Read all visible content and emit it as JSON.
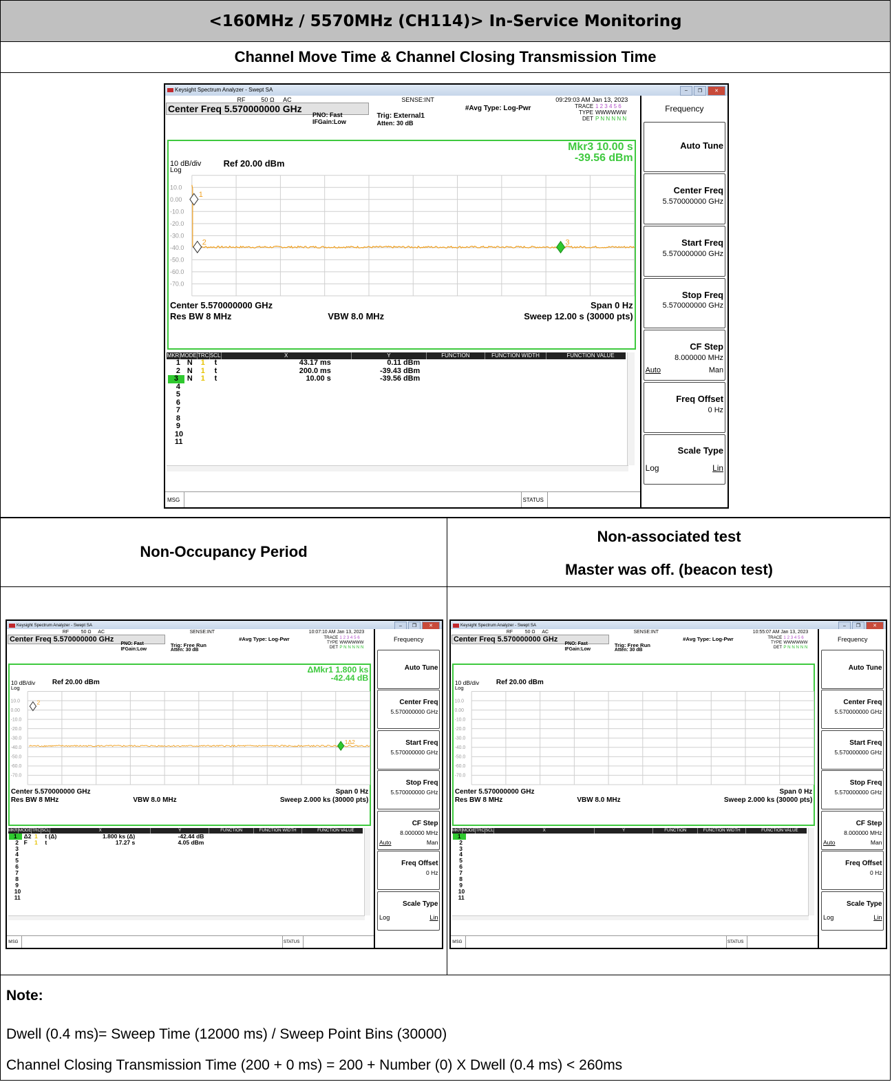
{
  "header": {
    "title": "<160MHz / 5570MHz (CH114)> In-Service Monitoring",
    "section1": "Channel Move Time & Channel Closing Transmission Time",
    "section2_left": "Non-Occupancy Period",
    "section2_right_line1": "Non-associated test",
    "section2_right_line2": "Master was off. (beacon test)"
  },
  "note": {
    "label": "Note:",
    "line1": "Dwell (0.4 ms)= Sweep Time (12000 ms) / Sweep Point Bins (30000)",
    "line2": "Channel Closing Transmission Time (200 + 0 ms) = 200 + Number (0) X Dwell (0.4 ms) < 260ms"
  },
  "screens": [
    {
      "app_title": "Keysight Spectrum Analyzer - Swept SA",
      "rf": "RF",
      "impedance": "50 Ω",
      "coupling": "AC",
      "sense": "SENSE:INT",
      "time": "09:29:03 AM Jan 13, 2023",
      "center_freq": "Center Freq 5.570000000 GHz",
      "pno": "PNO: Fast",
      "ifgain": "IFGain:Low",
      "trig": "Trig: External1",
      "atten": "Atten: 30 dB",
      "avg_type": "#Avg Type: Log-Pwr",
      "trace_label": "TRACE",
      "trace_nums": "1 2 3 4 5 6",
      "type_label": "TYPE",
      "type_val": "WWWWWW",
      "det_label": "DET",
      "det_val": "P N N N N N",
      "marker_readout_1": "Mkr3 10.00 s",
      "marker_readout_2": "-39.56 dBm",
      "scale": "10 dB/div",
      "ref": "Ref 20.00 dBm",
      "log": "Log",
      "y_ticks": [
        "10.0",
        "0.00",
        "-10.0",
        "-20.0",
        "-30.0",
        "-40.0",
        "-50.0",
        "-60.0",
        "-70.0"
      ],
      "center": "Center 5.570000000 GHz",
      "span": "Span 0 Hz",
      "rbw": "Res BW 8 MHz",
      "vbw": "VBW 8.0 MHz",
      "sweep": "Sweep  12.00 s (30000 pts)",
      "markers": [
        {
          "label": "1",
          "x": 0.043,
          "y": 0.11
        },
        {
          "label": "2",
          "x": 0.2,
          "y": -39.43
        },
        {
          "label": "3",
          "x": 10.0,
          "y": -39.56
        }
      ],
      "trace_level": -39.5,
      "table_headers": [
        "MKR",
        "MODE",
        "TRC",
        "SCL",
        "X",
        "Y",
        "FUNCTION",
        "FUNCTION WIDTH",
        "FUNCTION VALUE"
      ],
      "table_rows": [
        [
          "1",
          "N",
          "1",
          "t",
          "43.17 ms",
          "0.11 dBm"
        ],
        [
          "2",
          "N",
          "1",
          "t",
          "200.0 ms",
          "-39.43 dBm"
        ],
        [
          "3",
          "N",
          "1",
          "t",
          "10.00 s",
          "-39.56 dBm"
        ],
        [
          "4",
          "",
          "",
          "",
          "",
          ""
        ],
        [
          "5",
          "",
          "",
          "",
          "",
          ""
        ],
        [
          "6",
          "",
          "",
          "",
          "",
          ""
        ],
        [
          "7",
          "",
          "",
          "",
          "",
          ""
        ],
        [
          "8",
          "",
          "",
          "",
          "",
          ""
        ],
        [
          "9",
          "",
          "",
          "",
          "",
          ""
        ],
        [
          "10",
          "",
          "",
          "",
          "",
          ""
        ],
        [
          "11",
          "",
          "",
          "",
          "",
          ""
        ]
      ],
      "msg": "MSG",
      "status": "STATUS",
      "menu": {
        "title": "Frequency",
        "auto_tune": "Auto Tune",
        "center_freq": "Center Freq",
        "center_val": "5.570000000 GHz",
        "start_freq": "Start Freq",
        "start_val": "5.570000000 GHz",
        "stop_freq": "Stop Freq",
        "stop_val": "5.570000000 GHz",
        "cf_step": "CF Step",
        "cf_step_val": "8.000000 MHz",
        "auto": "Auto",
        "man": "Man",
        "freq_offset": "Freq Offset",
        "freq_offset_val": "0 Hz",
        "scale_type": "Scale Type",
        "log": "Log",
        "lin": "Lin"
      }
    },
    {
      "app_title": "Keysight Spectrum Analyzer - Swept SA",
      "rf": "RF",
      "impedance": "50 Ω",
      "coupling": "AC",
      "sense": "SENSE:INT",
      "time": "10:07:10 AM Jan 13, 2023",
      "center_freq": "Center Freq 5.570000000 GHz",
      "pno": "PNO: Fast",
      "ifgain": "IFGain:Low",
      "trig": "Trig: Free Run",
      "atten": "Atten: 30 dB",
      "avg_type": "#Avg Type: Log-Pwr",
      "trace_label": "TRACE",
      "trace_nums": "1 2 3 4 5 6",
      "type_label": "TYPE",
      "type_val": "WWWWWW",
      "det_label": "DET",
      "det_val": "P N N N N N",
      "marker_readout_1": "ΔMkr1 1.800 ks",
      "marker_readout_2": "-42.44 dB",
      "scale": "10 dB/div",
      "ref": "Ref 20.00 dBm",
      "log": "Log",
      "y_ticks": [
        "10.0",
        "0.00",
        "-10.0",
        "-20.0",
        "-30.0",
        "-40.0",
        "-50.0",
        "-60.0",
        "-70.0"
      ],
      "center": "Center 5.570000000 GHz",
      "span": "Span 0 Hz",
      "rbw": "Res BW 8 MHz",
      "vbw": "VBW 8.0 MHz",
      "sweep": "Sweep  2.000 ks (30000 pts)",
      "markers": [
        {
          "label": "2",
          "x": 17.27,
          "y": 4.05
        },
        {
          "label": "1Δ2",
          "x": 1817.27,
          "y": -38.4
        }
      ],
      "trace_level": -38.5,
      "table_headers": [
        "MKR",
        "MODE",
        "TRC",
        "SCL",
        "X",
        "Y",
        "FUNCTION",
        "FUNCTION WIDTH",
        "FUNCTION VALUE"
      ],
      "table_rows": [
        [
          "1",
          "Δ2",
          "1",
          "t  (Δ)",
          "1.800 ks  (Δ)",
          "-42.44 dB"
        ],
        [
          "2",
          "F",
          "1",
          "t",
          "17.27 s",
          "4.05 dBm"
        ],
        [
          "3",
          "",
          "",
          "",
          "",
          ""
        ],
        [
          "4",
          "",
          "",
          "",
          "",
          ""
        ],
        [
          "5",
          "",
          "",
          "",
          "",
          ""
        ],
        [
          "6",
          "",
          "",
          "",
          "",
          ""
        ],
        [
          "7",
          "",
          "",
          "",
          "",
          ""
        ],
        [
          "8",
          "",
          "",
          "",
          "",
          ""
        ],
        [
          "9",
          "",
          "",
          "",
          "",
          ""
        ],
        [
          "10",
          "",
          "",
          "",
          "",
          ""
        ],
        [
          "11",
          "",
          "",
          "",
          "",
          ""
        ]
      ],
      "msg": "MSG",
      "status": "STATUS",
      "menu": {
        "title": "Frequency",
        "auto_tune": "Auto Tune",
        "center_freq": "Center Freq",
        "center_val": "5.570000000 GHz",
        "start_freq": "Start Freq",
        "start_val": "5.570000000 GHz",
        "stop_freq": "Stop Freq",
        "stop_val": "5.570000000 GHz",
        "cf_step": "CF Step",
        "cf_step_val": "8.000000 MHz",
        "auto": "Auto",
        "man": "Man",
        "freq_offset": "Freq Offset",
        "freq_offset_val": "0 Hz",
        "scale_type": "Scale Type",
        "log": "Log",
        "lin": "Lin"
      }
    },
    {
      "app_title": "Keysight Spectrum Analyzer - Swept SA",
      "rf": "RF",
      "impedance": "50 Ω",
      "coupling": "AC",
      "sense": "SENSE:INT",
      "time": "10:55:07 AM Jan 13, 2023",
      "center_freq": "Center Freq 5.570000000 GHz",
      "pno": "PNO: Fast",
      "ifgain": "IFGain:Low",
      "trig": "Trig: Free Run",
      "atten": "Atten: 30 dB",
      "avg_type": "#Avg Type: Log-Pwr",
      "trace_label": "TRACE",
      "trace_nums": "1 2 3 4 5 6",
      "type_label": "TYPE",
      "type_val": "WWWWWW",
      "det_label": "DET",
      "det_val": "P N N N N N",
      "marker_readout_1": "",
      "marker_readout_2": "",
      "scale": "10 dB/div",
      "ref": "Ref 20.00 dBm",
      "log": "Log",
      "y_ticks": [
        "10.0",
        "0.00",
        "-10.0",
        "-20.0",
        "-30.0",
        "-40.0",
        "-50.0",
        "-60.0",
        "-70.0"
      ],
      "center": "Center 5.570000000 GHz",
      "span": "Span 0 Hz",
      "rbw": "Res BW 8 MHz",
      "vbw": "VBW 8.0 MHz",
      "sweep": "Sweep  2.000 ks (30000 pts)",
      "markers": [],
      "trace_level": null,
      "table_headers": [
        "MKR",
        "MODE",
        "TRC",
        "SCL",
        "X",
        "Y",
        "FUNCTION",
        "FUNCTION WIDTH",
        "FUNCTION VALUE"
      ],
      "table_rows": [
        [
          "1",
          "",
          "",
          "",
          "",
          ""
        ],
        [
          "2",
          "",
          "",
          "",
          "",
          ""
        ],
        [
          "3",
          "",
          "",
          "",
          "",
          ""
        ],
        [
          "4",
          "",
          "",
          "",
          "",
          ""
        ],
        [
          "5",
          "",
          "",
          "",
          "",
          ""
        ],
        [
          "6",
          "",
          "",
          "",
          "",
          ""
        ],
        [
          "7",
          "",
          "",
          "",
          "",
          ""
        ],
        [
          "8",
          "",
          "",
          "",
          "",
          ""
        ],
        [
          "9",
          "",
          "",
          "",
          "",
          ""
        ],
        [
          "10",
          "",
          "",
          "",
          "",
          ""
        ],
        [
          "11",
          "",
          "",
          "",
          "",
          ""
        ]
      ],
      "msg": "MSG",
      "status": "STATUS",
      "menu": {
        "title": "Frequency",
        "auto_tune": "Auto Tune",
        "center_freq": "Center Freq",
        "center_val": "5.570000000 GHz",
        "start_freq": "Start Freq",
        "start_val": "5.570000000 GHz",
        "stop_freq": "Stop Freq",
        "stop_val": "5.570000000 GHz",
        "cf_step": "CF Step",
        "cf_step_val": "8.000000 MHz",
        "auto": "Auto",
        "man": "Man",
        "freq_offset": "Freq Offset",
        "freq_offset_val": "0 Hz",
        "scale_type": "Scale Type",
        "log": "Log",
        "lin": "Lin"
      }
    }
  ]
}
